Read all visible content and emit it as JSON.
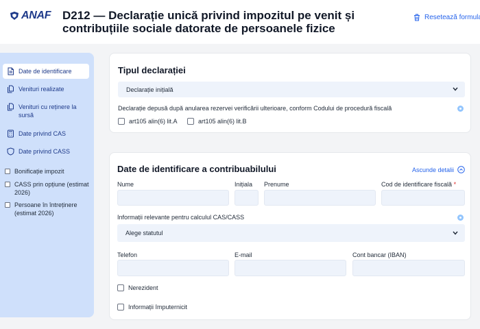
{
  "header": {
    "logo_text": "ANAF",
    "title": "D212 — Declarație unică privind impozitul pe venit și contribuțiile sociale datorate de persoanele fizice",
    "reset_label": "Resetează formularul"
  },
  "sidebar": {
    "items": [
      {
        "label": "Date de identificare",
        "icon": "document-icon",
        "active": true
      },
      {
        "label": "Venituri realizate",
        "icon": "documents-icon",
        "active": false
      },
      {
        "label": "Venituri cu reținere la sursă",
        "icon": "documents-icon",
        "active": false
      },
      {
        "label": "Date privind CAS",
        "icon": "calculator-icon",
        "active": false
      },
      {
        "label": "Date privind CASS",
        "icon": "shield-icon",
        "active": false
      }
    ],
    "checks": [
      {
        "label": "Bonificație impozit"
      },
      {
        "label": "CASS prin opțiune (estimat 2026)"
      },
      {
        "label": "Persoane în întreținere (estimat 2026)"
      }
    ]
  },
  "declaration_type": {
    "title": "Tipul declarației",
    "selected": "Declarație inițială",
    "note": "Declarație depusă după anularea rezervei verificării ulterioare, conform Codului de procedură fiscală",
    "options": [
      {
        "label": "art105 alin(6) lit.A"
      },
      {
        "label": "art105 alin(6) lit.B"
      }
    ]
  },
  "identification": {
    "title": "Date de identificare a contribuabilului",
    "toggle_label": "Ascunde detalii",
    "fields": {
      "nume": "Nume",
      "initiala": "Inițiala",
      "prenume": "Prenume",
      "cif": "Cod de identificare fiscală",
      "required_mark": "*"
    },
    "cas_label": "Informații relevante pentru calculul CAS/CASS",
    "status_select": "Alege statutul",
    "telefon": "Telefon",
    "email": "E-mail",
    "iban": "Cont bancar (IBAN)",
    "nerezident": "Nerezident",
    "imputernicit": "Informații împuternicit"
  },
  "colors": {
    "accent": "#2563eb",
    "sidebar_bg": "#cfe0fb",
    "input_bg": "#eef3fb",
    "brand": "#1e3a8a"
  }
}
